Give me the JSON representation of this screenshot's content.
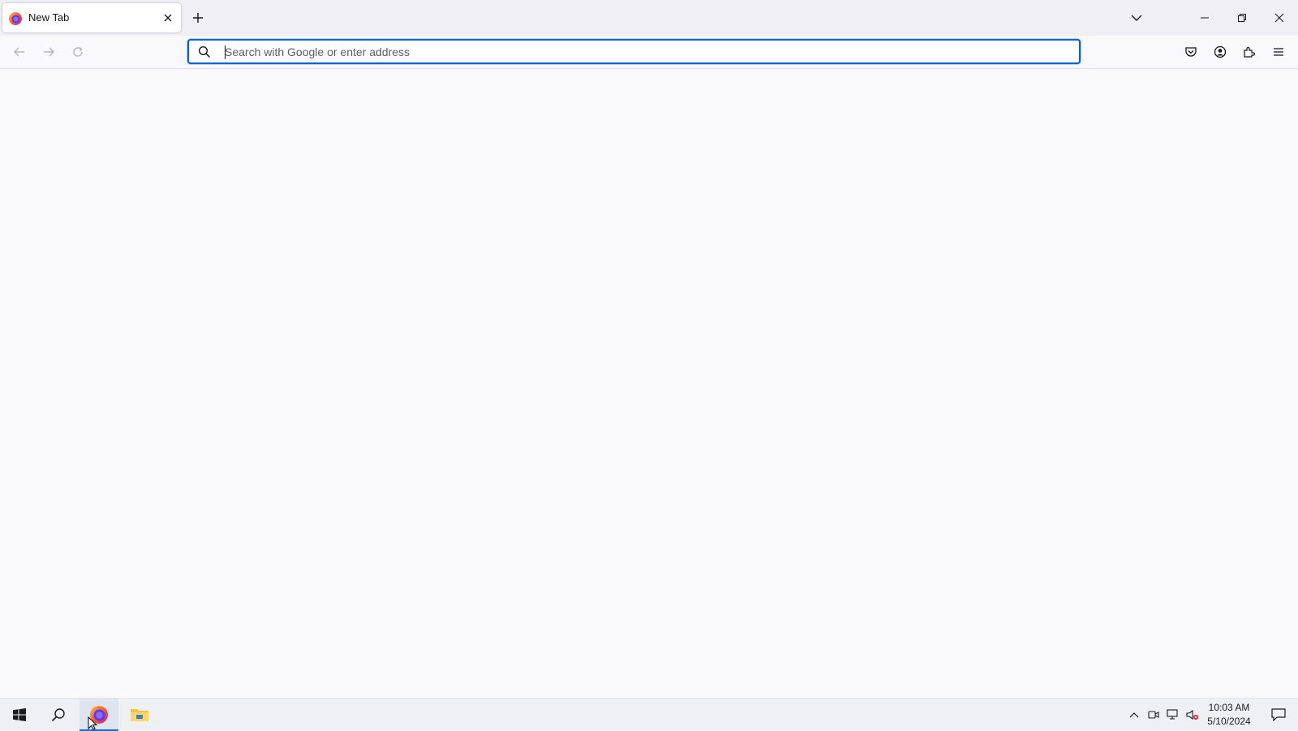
{
  "browser": {
    "tab": {
      "title": "New Tab",
      "favicon": "firefox-logo-icon",
      "close_icon": "close-icon"
    },
    "new_tab_icon": "plus-icon",
    "tabs_list_icon": "chevron-down-icon",
    "window_controls": [
      "minimize-icon",
      "restore-icon",
      "close-icon"
    ],
    "nav": {
      "back_icon": "arrow-left-icon",
      "forward_icon": "arrow-right-icon",
      "reload_icon": "reload-icon"
    },
    "urlbar": {
      "placeholder": "Search with Google or enter address",
      "value": "",
      "search_icon": "search-icon",
      "focused": true
    },
    "toolbar": [
      "pocket-icon",
      "account-icon",
      "extensions-icon",
      "menu-icon"
    ],
    "accent": "#0061e0"
  },
  "taskbar": {
    "pinned": [
      "windows-start-icon",
      "search-icon",
      "firefox-icon",
      "file-explorer-icon"
    ],
    "active_app": "firefox",
    "tray": [
      "chevron-up-icon",
      "meet-now-icon",
      "network-icon",
      "volume-muted-icon",
      "action-center-icon"
    ],
    "clock": {
      "time": "10:03 AM",
      "date": "5/10/2024"
    }
  }
}
